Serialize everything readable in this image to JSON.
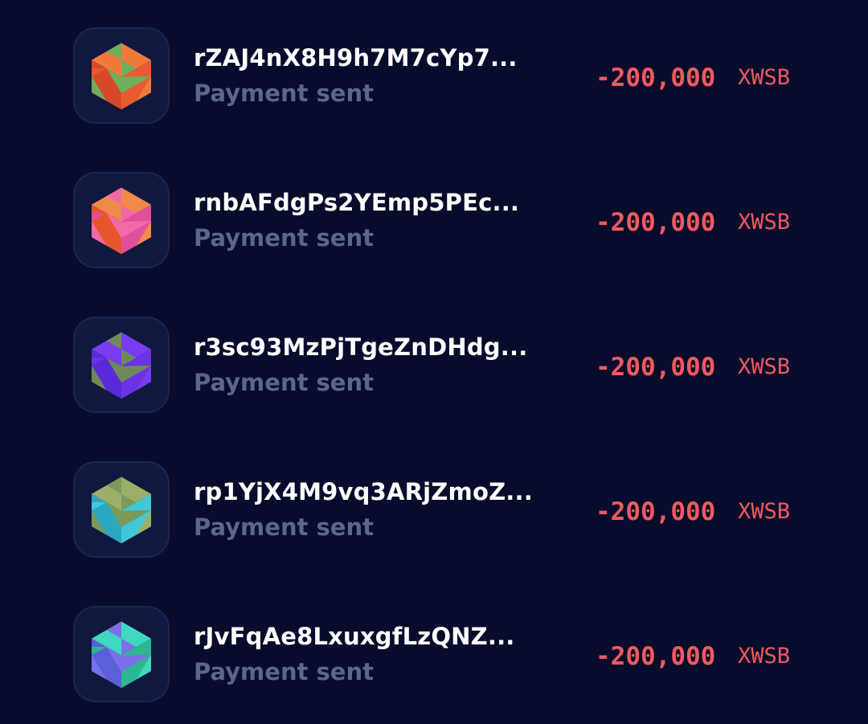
{
  "transactions": [
    {
      "address": "rZAJ4nX8H9h7M7cYp7...",
      "status": "Payment sent",
      "amount": "-200,000",
      "currency": "XWSB",
      "avatar_icon": "orange-green-cube-identicon",
      "avatar_colors": {
        "top": "#f07a3c",
        "left": "#d9482a",
        "right": "#ea5a30",
        "accent": "#6fae5a"
      }
    },
    {
      "address": "rnbAFdgPs2YEmp5PEc...",
      "status": "Payment sent",
      "amount": "-200,000",
      "currency": "XWSB",
      "avatar_icon": "orange-pink-cube-identicon",
      "avatar_colors": {
        "top": "#f08a4a",
        "left": "#e8542c",
        "right": "#e0509a",
        "accent": "#f06aa8"
      }
    },
    {
      "address": "r3sc93MzPjTgeZnDHdg...",
      "status": "Payment sent",
      "amount": "-200,000",
      "currency": "XWSB",
      "avatar_icon": "purple-olive-cube-identicon",
      "avatar_colors": {
        "top": "#7a3cf0",
        "left": "#5a2ad8",
        "right": "#6a34e4",
        "accent": "#6f8a5a"
      }
    },
    {
      "address": "rp1YjX4M9vq3ARjZmoZ...",
      "status": "Payment sent",
      "amount": "-200,000",
      "currency": "XWSB",
      "avatar_icon": "olive-cyan-cube-identicon",
      "avatar_colors": {
        "top": "#9ab068",
        "left": "#2aa8c0",
        "right": "#40c8d8",
        "accent": "#7a9a5a"
      }
    },
    {
      "address": "rJvFqAe8LxuxgfLzQNZ...",
      "status": "Payment sent",
      "amount": "-200,000",
      "currency": "XWSB",
      "avatar_icon": "blue-teal-cube-identicon",
      "avatar_colors": {
        "top": "#40d8c0",
        "left": "#5a60d8",
        "right": "#2ab890",
        "accent": "#7a70e8"
      }
    }
  ]
}
